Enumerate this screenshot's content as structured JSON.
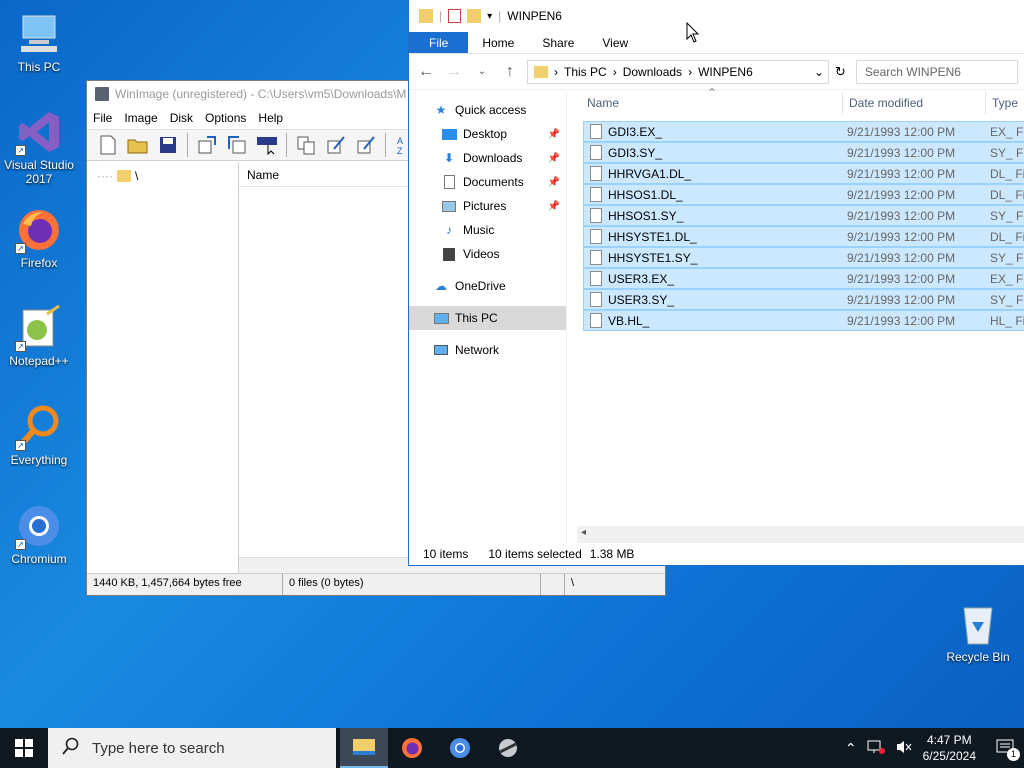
{
  "desktop": {
    "icons": [
      {
        "label": "This PC"
      },
      {
        "label": "Visual Studio 2017"
      },
      {
        "label": "Firefox"
      },
      {
        "label": "Notepad++"
      },
      {
        "label": "Everything"
      },
      {
        "label": "Chromium"
      }
    ],
    "recycle_bin": "Recycle Bin"
  },
  "winimage": {
    "title": "WinImage (unregistered) - C:\\Users\\vm5\\Downloads\\M",
    "menu": [
      "File",
      "Image",
      "Disk",
      "Options",
      "Help"
    ],
    "tree_root": "\\",
    "list_header": "Name",
    "status": [
      "1440 KB, 1,457,664 bytes free",
      "0 files (0 bytes)",
      "",
      "\\"
    ]
  },
  "explorer": {
    "title": "WINPEN6",
    "tabs": [
      "File",
      "Home",
      "Share",
      "View"
    ],
    "breadcrumb": [
      "This PC",
      "Downloads",
      "WINPEN6"
    ],
    "search_placeholder": "Search WINPEN6",
    "nav": {
      "quick_access": "Quick access",
      "desktop": "Desktop",
      "downloads": "Downloads",
      "documents": "Documents",
      "pictures": "Pictures",
      "music": "Music",
      "videos": "Videos",
      "onedrive": "OneDrive",
      "this_pc": "This PC",
      "network": "Network"
    },
    "columns": {
      "name": "Name",
      "date": "Date modified",
      "type": "Type"
    },
    "files": [
      {
        "name": "GDI3.EX_",
        "date": "9/21/1993 12:00 PM",
        "type": "EX_ Fil"
      },
      {
        "name": "GDI3.SY_",
        "date": "9/21/1993 12:00 PM",
        "type": "SY_ Fil"
      },
      {
        "name": "HHRVGA1.DL_",
        "date": "9/21/1993 12:00 PM",
        "type": "DL_ Fil"
      },
      {
        "name": "HHSOS1.DL_",
        "date": "9/21/1993 12:00 PM",
        "type": "DL_ Fil"
      },
      {
        "name": "HHSOS1.SY_",
        "date": "9/21/1993 12:00 PM",
        "type": "SY_ Fil"
      },
      {
        "name": "HHSYSTE1.DL_",
        "date": "9/21/1993 12:00 PM",
        "type": "DL_ Fil"
      },
      {
        "name": "HHSYSTE1.SY_",
        "date": "9/21/1993 12:00 PM",
        "type": "SY_ Fil"
      },
      {
        "name": "USER3.EX_",
        "date": "9/21/1993 12:00 PM",
        "type": "EX_ Fil"
      },
      {
        "name": "USER3.SY_",
        "date": "9/21/1993 12:00 PM",
        "type": "SY_ Fil"
      },
      {
        "name": "VB.HL_",
        "date": "9/21/1993 12:00 PM",
        "type": "HL_ Fi"
      }
    ],
    "status": {
      "count": "10 items",
      "selected": "10 items selected",
      "size": "1.38 MB"
    }
  },
  "taskbar": {
    "search_placeholder": "Type here to search",
    "time": "4:47 PM",
    "date": "6/25/2024",
    "notification_count": "1"
  }
}
